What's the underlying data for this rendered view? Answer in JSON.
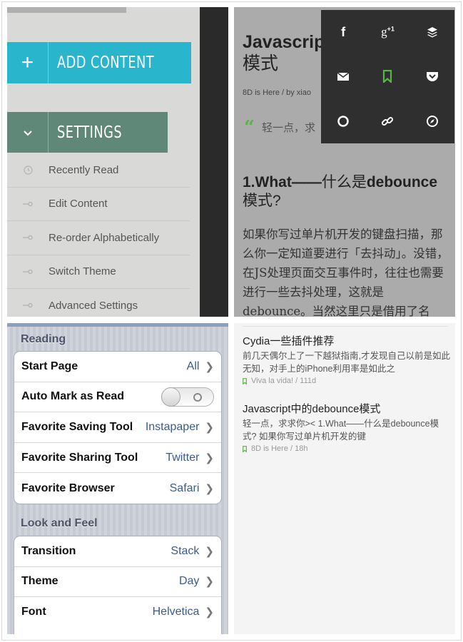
{
  "colors": {
    "add_content": "#29b6cc",
    "settings": "#5f8878",
    "accent_green": "#5bb34a",
    "ios_value": "#3b5b8f"
  },
  "sidebar": {
    "add_content": {
      "label": "ADD CONTENT",
      "icon": "plus-icon"
    },
    "settings": {
      "label": "SETTINGS",
      "icon": "chevron-down-icon"
    },
    "items": [
      {
        "label": "Recently Read",
        "icon": "clock-icon"
      },
      {
        "label": "Edit Content",
        "icon": "key-icon"
      },
      {
        "label": "Re-order Alphabetically",
        "icon": "key-icon"
      },
      {
        "label": "Switch Theme",
        "icon": "key-icon"
      },
      {
        "label": "Advanced Settings",
        "icon": "key-icon"
      }
    ]
  },
  "article": {
    "title_latin": "Javascript",
    "title_cn": "模式",
    "meta": "8D is Here / by xiao",
    "quote": "轻一点，求",
    "heading_bold": "1.What——",
    "heading_mid": "什么是",
    "heading_bold2": "debounce",
    "heading_end": "模式?",
    "body": "如果你写过单片机开发的键盘扫描，那么你一定知道要进行「去抖动」。没错，在JS处理页面交互事件时，往往也需要进行一些去抖处理，这就是debounce。当然这里只是借用了名"
  },
  "share": {
    "items": [
      {
        "name": "facebook-icon",
        "glyph": "f"
      },
      {
        "name": "google-plus-icon",
        "glyph": "g+1"
      },
      {
        "name": "buffer-icon",
        "glyph": ""
      },
      {
        "name": "email-icon",
        "glyph": ""
      },
      {
        "name": "bookmark-icon",
        "glyph": ""
      },
      {
        "name": "pocket-icon",
        "glyph": ""
      },
      {
        "name": "circle-icon",
        "glyph": ""
      },
      {
        "name": "link-icon",
        "glyph": ""
      },
      {
        "name": "compass-icon",
        "glyph": ""
      }
    ]
  },
  "ios": {
    "reading_header": "Reading",
    "reading": [
      {
        "label": "Start Page",
        "value": "All"
      },
      {
        "label": "Auto Mark as Read",
        "value": "",
        "toggle": true
      },
      {
        "label": "Favorite Saving Tool",
        "value": "Instapaper"
      },
      {
        "label": "Favorite Sharing Tool",
        "value": "Twitter"
      },
      {
        "label": "Favorite Browser",
        "value": "Safari"
      }
    ],
    "look_header": "Look and Feel",
    "look": [
      {
        "label": "Transition",
        "value": "Stack"
      },
      {
        "label": "Theme",
        "value": "Day"
      },
      {
        "label": "Font",
        "value": "Helvetica"
      }
    ]
  },
  "reading_list": [
    {
      "title": "Cydia一些插件推荐",
      "snippet": "前几天偶尔上了一下越狱指南,才发现自己以前是如此无知，对手上的iPhone利用率是如此之",
      "source": "Viva la vida! / 111d"
    },
    {
      "title": "Javascript中的debounce模式",
      "snippet": "轻一点，求求你>< 1.What——什么是debounce模式?  如果你写过单片机开发的键",
      "source": "8D is Here / 18h"
    }
  ]
}
